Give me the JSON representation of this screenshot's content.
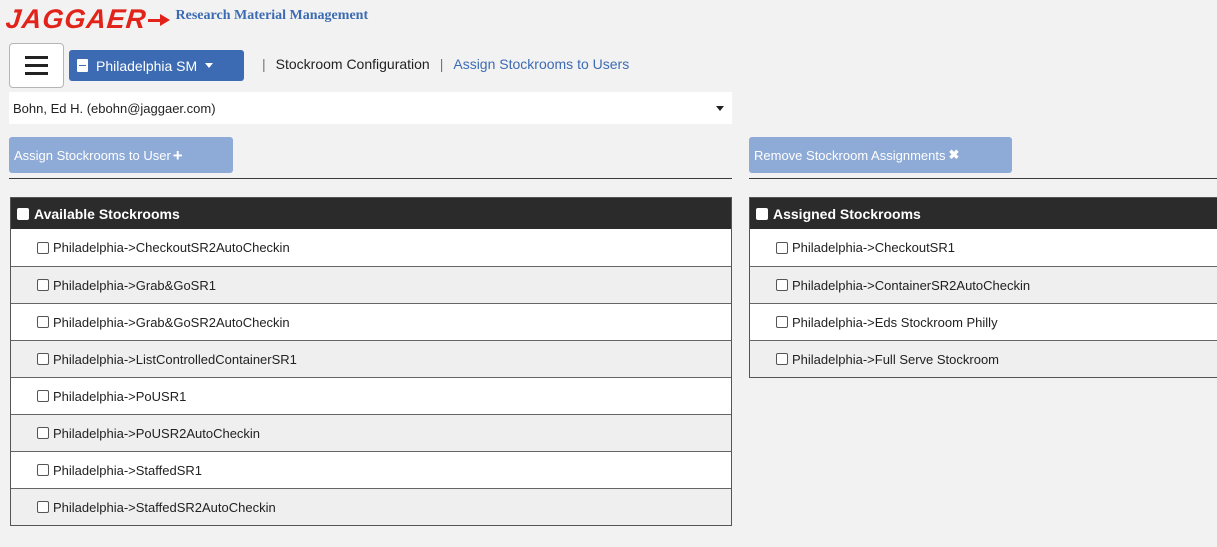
{
  "brand": {
    "logo_text": "JAGGAER",
    "app_title": "Research Material Management"
  },
  "header": {
    "site_selector": "Philadelphia SM",
    "breadcrumb_current": "Stockroom Configuration",
    "breadcrumb_link": "Assign Stockrooms to Users",
    "separator": "|"
  },
  "user_selector": {
    "value": "Bohn, Ed H. (ebohn@jaggaer.com)"
  },
  "actions": {
    "assign_label": "Assign Stockrooms to User",
    "remove_label": "Remove Stockroom Assignments"
  },
  "available": {
    "title": "Available Stockrooms",
    "items": [
      "Philadelphia->CheckoutSR2AutoCheckin",
      "Philadelphia->Grab&GoSR1",
      "Philadelphia->Grab&GoSR2AutoCheckin",
      "Philadelphia->ListControlledContainerSR1",
      "Philadelphia->PoUSR1",
      "Philadelphia->PoUSR2AutoCheckin",
      "Philadelphia->StaffedSR1",
      "Philadelphia->StaffedSR2AutoCheckin"
    ]
  },
  "assigned": {
    "title": "Assigned Stockrooms",
    "items": [
      "Philadelphia->CheckoutSR1",
      "Philadelphia->ContainerSR2AutoCheckin",
      "Philadelphia->Eds Stockroom Philly",
      "Philadelphia->Full Serve Stockroom"
    ]
  },
  "colors": {
    "brand_red": "#e2231a",
    "primary_blue": "#3d6bb3",
    "disabled_button": "#8eaad6",
    "panel_header": "#2b2b2b"
  },
  "icons": [
    "hamburger-menu-icon",
    "document-icon",
    "caret-down-icon",
    "plus-icon",
    "close-icon",
    "checkbox-icon"
  ]
}
